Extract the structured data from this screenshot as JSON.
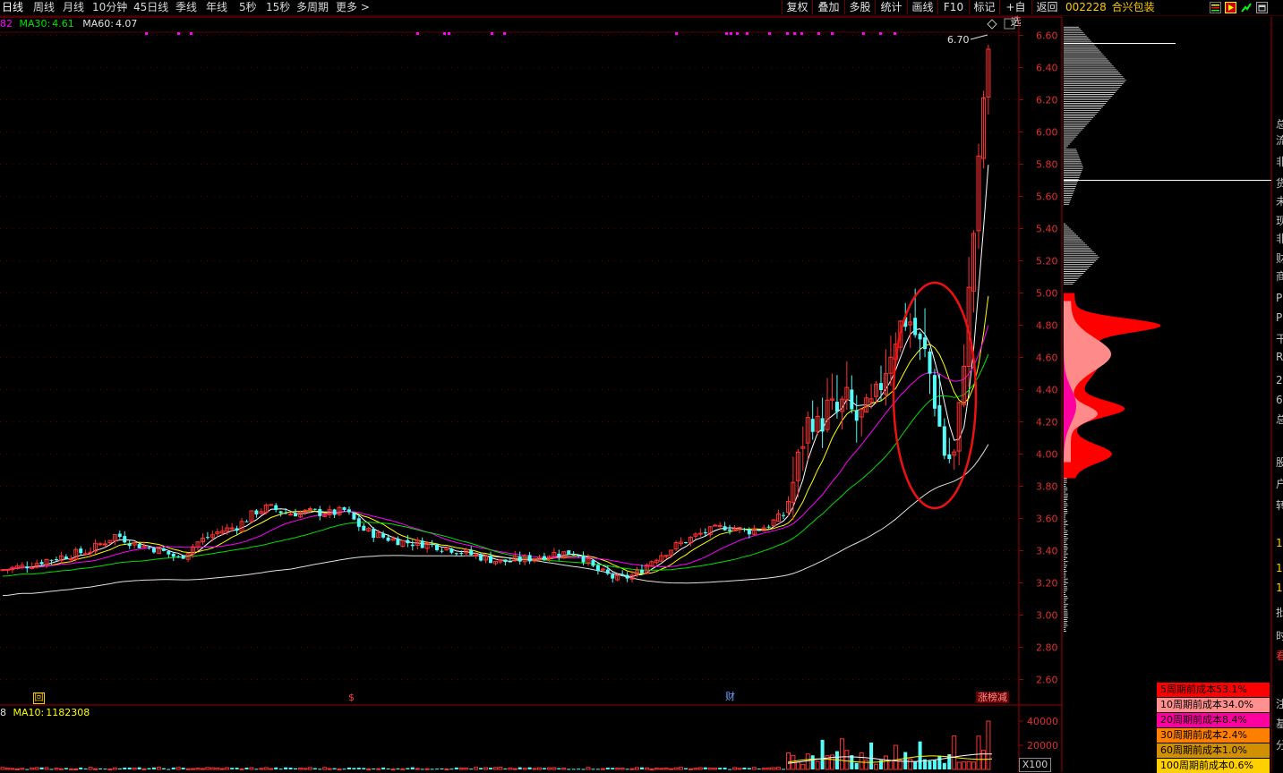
{
  "toolbar": {
    "periods": [
      "日线",
      "周线",
      "月线",
      "10分钟",
      "45日线",
      "季线",
      "年线",
      "5秒",
      "15秒",
      "多周期",
      "更多 >"
    ],
    "active_period": "日线",
    "buttons": [
      "复权",
      "叠加",
      "多股",
      "统计",
      "画线",
      "F10",
      "标记",
      "+自选",
      "返回"
    ]
  },
  "stock": {
    "code": "002228",
    "name": "合兴包装"
  },
  "indicators": {
    "ma_prefix": "82",
    "ma30_label": "MA30:",
    "ma30_value": "4.61",
    "ma60_label": "MA60:",
    "ma60_value": "4.07",
    "vol_prefix": "8",
    "vol_ma10_label": "MA10:",
    "vol_ma10_value": "1182308",
    "vol_unit": "X100"
  },
  "markers": {
    "high_label": "6.70",
    "bottom_icons": [
      "回",
      "$",
      "财",
      "涨榜减"
    ]
  },
  "chart_data": {
    "type": "candlestick",
    "ylim": [
      2.5,
      6.75
    ],
    "price_ticks": [
      "6.60",
      "6.40",
      "6.20",
      "6.00",
      "5.80",
      "5.60",
      "5.40",
      "5.20",
      "5.00",
      "4.80",
      "4.60",
      "4.40",
      "4.20",
      "4.00",
      "3.80",
      "3.60",
      "3.40",
      "3.20",
      "3.00",
      "2.80",
      "2.60"
    ],
    "volume_ticks": [
      "40000",
      "20000"
    ],
    "volume_ylim": [
      0,
      45000
    ],
    "colors": {
      "up": "#ff3232",
      "down": "#54fcfc",
      "ma5": "#ffffff",
      "ma10": "#ffff00",
      "ma20": "#ff00ff",
      "ma30": "#00e000",
      "ma60": "#e0e0e0",
      "axis": "#a00000"
    },
    "keypoints": [
      [
        0,
        3.28
      ],
      [
        25,
        3.3
      ],
      [
        50,
        3.34
      ],
      [
        75,
        3.37
      ],
      [
        100,
        3.4
      ],
      [
        115,
        3.45
      ],
      [
        130,
        3.5
      ],
      [
        150,
        3.44
      ],
      [
        175,
        3.41
      ],
      [
        200,
        3.35
      ],
      [
        220,
        3.45
      ],
      [
        245,
        3.52
      ],
      [
        265,
        3.55
      ],
      [
        285,
        3.64
      ],
      [
        300,
        3.67
      ],
      [
        320,
        3.63
      ],
      [
        345,
        3.64
      ],
      [
        370,
        3.63
      ],
      [
        385,
        3.65
      ],
      [
        405,
        3.53
      ],
      [
        430,
        3.48
      ],
      [
        455,
        3.45
      ],
      [
        480,
        3.44
      ],
      [
        505,
        3.41
      ],
      [
        530,
        3.37
      ],
      [
        545,
        3.35
      ],
      [
        560,
        3.33
      ],
      [
        590,
        3.35
      ],
      [
        615,
        3.38
      ],
      [
        645,
        3.39
      ],
      [
        665,
        3.28
      ],
      [
        690,
        3.22
      ],
      [
        710,
        3.25
      ],
      [
        730,
        3.35
      ],
      [
        755,
        3.43
      ],
      [
        780,
        3.5
      ],
      [
        810,
        3.55
      ],
      [
        835,
        3.52
      ],
      [
        855,
        3.55
      ],
      [
        875,
        3.62
      ],
      [
        885,
        3.8
      ],
      [
        895,
        4.05
      ],
      [
        905,
        4.25
      ],
      [
        915,
        4.15
      ],
      [
        925,
        4.3
      ],
      [
        935,
        4.25
      ],
      [
        945,
        4.35
      ],
      [
        955,
        4.2
      ],
      [
        965,
        4.25
      ],
      [
        975,
        4.3
      ],
      [
        985,
        4.45
      ],
      [
        995,
        4.65
      ],
      [
        1005,
        4.8
      ],
      [
        1015,
        4.85
      ],
      [
        1025,
        4.7
      ],
      [
        1035,
        4.6
      ],
      [
        1045,
        4.3
      ],
      [
        1055,
        4.0
      ],
      [
        1065,
        3.95
      ],
      [
        1072,
        4.3
      ],
      [
        1078,
        4.7
      ],
      [
        1085,
        5.2
      ],
      [
        1092,
        5.7
      ],
      [
        1098,
        6.2
      ],
      [
        1104,
        6.45
      ]
    ],
    "volume_profile": {
      "white_peaks": [
        [
          6.6,
          1310
        ],
        [
          6.3,
          1258
        ],
        [
          5.75,
          1210
        ],
        [
          5.2,
          1230
        ]
      ],
      "red_region": [
        [
          4.8,
          1278
        ],
        [
          4.3,
          1245
        ],
        [
          4.0,
          1232
        ]
      ]
    },
    "cost_legend": [
      {
        "label": "5周期前成本53.1%",
        "color": "#ff0000"
      },
      {
        "label": "10周期前成本34.0%",
        "color": "#ff9090"
      },
      {
        "label": "20周期前成本8.4%",
        "color": "#ff00a0"
      },
      {
        "label": "30周期前成本2.4%",
        "color": "#ff8000"
      },
      {
        "label": "60周期前成本1.0%",
        "color": "#d09000"
      },
      {
        "label": "100周期前成本0.6%",
        "color": "#ffd000"
      }
    ]
  },
  "right_edge": [
    "总",
    "流",
    "非",
    "货",
    "未",
    "现",
    "非",
    "财",
    "商",
    "P",
    "P",
    "干",
    "R",
    "2",
    "6",
    "总",
    "股",
    "户",
    "转",
    "1",
    "1",
    "1",
    "批",
    "时",
    "看",
    "注",
    "基",
    "分"
  ]
}
